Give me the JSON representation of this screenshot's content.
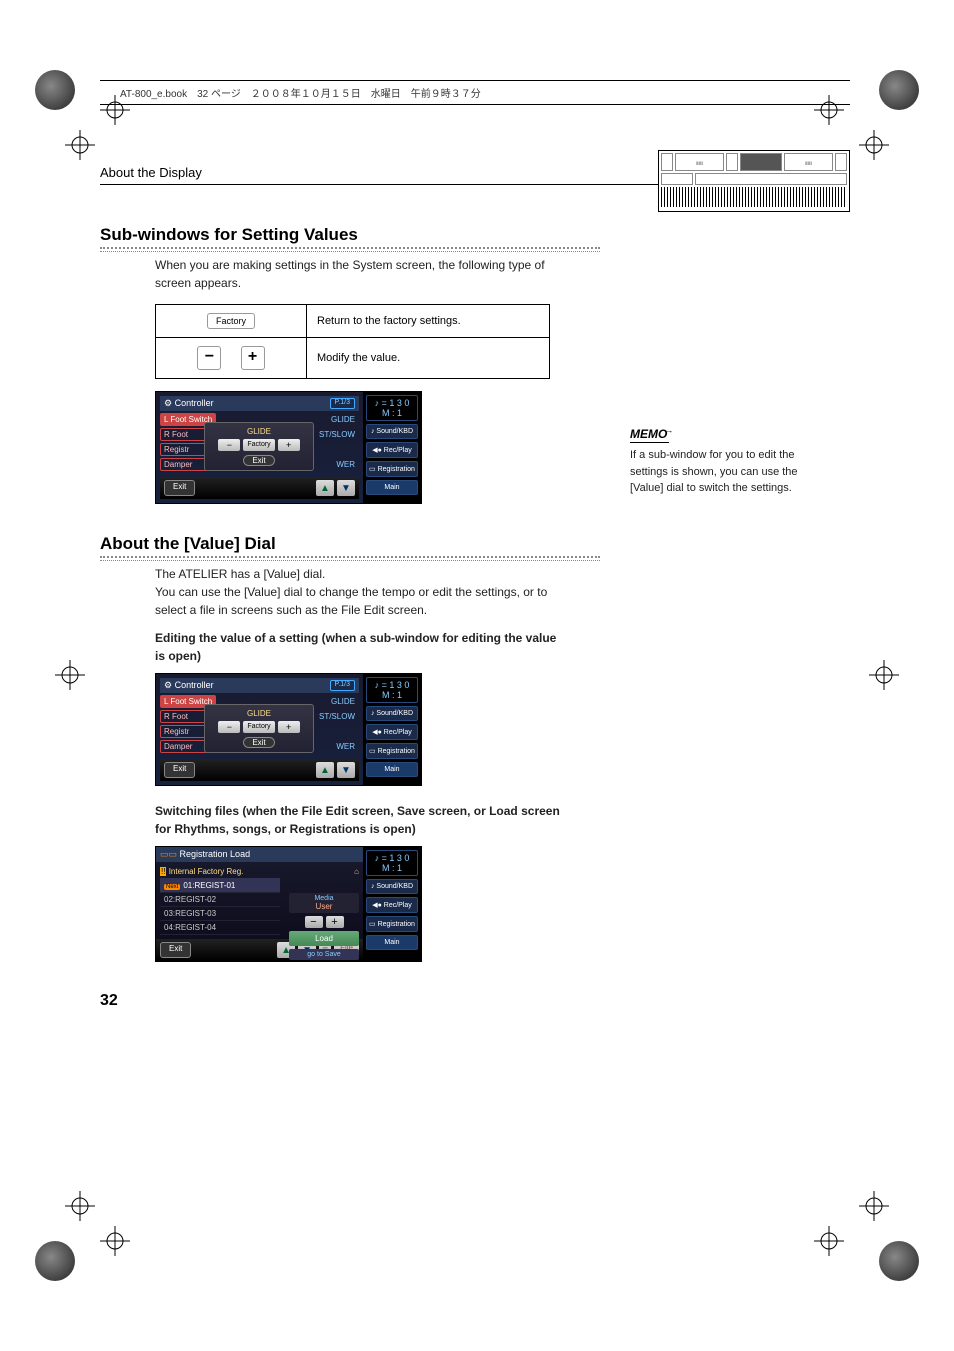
{
  "header": {
    "book_info": "AT-800_e.book　32 ページ　２００８年１０月１５日　水曜日　午前９時３７分"
  },
  "section": {
    "title": "About the Display"
  },
  "subwindows": {
    "heading": "Sub-windows for Setting Values",
    "intro": "When you are making settings in the System screen, the following type of screen appears.",
    "table": {
      "row1": {
        "icon_label": "Factory",
        "desc": "Return to the factory settings."
      },
      "row2": {
        "minus": "−",
        "plus": "+",
        "desc": "Modify the value."
      }
    }
  },
  "memo": {
    "label": "MEMO",
    "text": "If a sub-window for you to edit the settings is shown, you can use the [Value] dial to switch the settings."
  },
  "value_dial": {
    "heading": "About the [Value] Dial",
    "intro1": "The ATELIER has a [Value] dial.",
    "intro2": "You can use the [Value] dial to change the tempo or edit the settings, or to select a file in screens such as the File Edit screen.",
    "caption1": "Editing the value of a setting (when a sub-window for editing the value is open)",
    "caption2": "Switching files (when the File Edit screen, Save screen, or Load screen for Rhythms, songs, or Registrations is open)"
  },
  "device": {
    "controller": {
      "title": "Controller",
      "page": "P.1/3",
      "tempo_j": "♪ = 1 3 0",
      "tempo_m": "M :      1",
      "rows": {
        "lfoot": {
          "label": "L Foot Switch",
          "value": "GLIDE"
        },
        "rfoot": {
          "label": "R Foot",
          "value": "ST/SLOW"
        },
        "registr": {
          "label": "Registr",
          "value": ""
        },
        "damper": {
          "label": "Damper",
          "value": "WER"
        }
      },
      "popup": {
        "title": "GLIDE",
        "minus": "−",
        "factory": "Factory",
        "plus": "+",
        "exit": "Exit"
      },
      "exit": "Exit",
      "side": {
        "sound": "Sound/KBD",
        "recplay": "Rec/Play",
        "registration": "Registration",
        "main": "Main"
      }
    },
    "reg_load": {
      "title": "Registration Load",
      "crumb": "Internal Factory Reg.",
      "items": [
        "01:REGIST-01",
        "02:REGIST-02",
        "03:REGIST-03",
        "04:REGIST-04"
      ],
      "next": "Next",
      "media_label": "Media",
      "media_value": "User",
      "load": "Load",
      "go_save": "go to Save",
      "file": "File",
      "exit": "Exit",
      "tempo_j": "♪ = 1 3 0",
      "tempo_m": "M :      1",
      "side": {
        "sound": "Sound/KBD",
        "recplay": "Rec/Play",
        "registration": "Registration",
        "main": "Main"
      }
    }
  },
  "page_number": "32"
}
